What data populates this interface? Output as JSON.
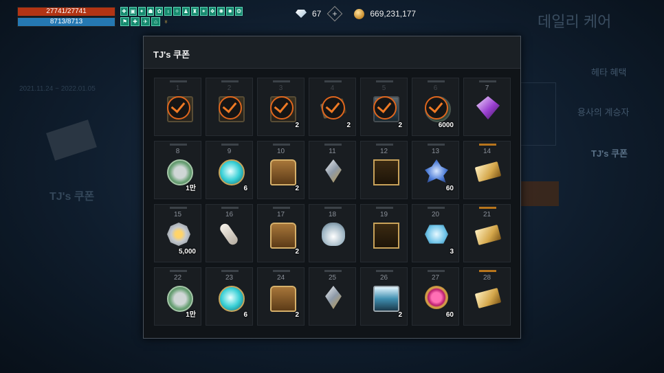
{
  "player": {
    "hp": "27741/27741",
    "mp": "8713/8713"
  },
  "currency": {
    "diamonds": "67",
    "gold": "669,231,177"
  },
  "background": {
    "title": "데일리 케어",
    "menu": [
      "헤타 혜택",
      "용사의 계승자",
      "TJ's 쿠폰"
    ],
    "date": "2021.11.24 ~ 2022.01.05",
    "card_title": "TJ's 쿠폰"
  },
  "modal": {
    "title": "TJ's 쿠폰",
    "items": [
      {
        "day": "1",
        "qty": "",
        "icon": "gift-box-icon",
        "claimed": true
      },
      {
        "day": "2",
        "qty": "",
        "icon": "chest-icon",
        "claimed": true
      },
      {
        "day": "3",
        "qty": "2",
        "icon": "chest-icon",
        "claimed": true
      },
      {
        "day": "4",
        "qty": "2",
        "icon": "ticket-icon",
        "claimed": true
      },
      {
        "day": "5",
        "qty": "2",
        "icon": "lantern-icon",
        "claimed": true
      },
      {
        "day": "6",
        "qty": "6000",
        "icon": "coin-icon",
        "claimed": true
      },
      {
        "day": "7",
        "qty": "",
        "icon": "purple-gem-icon",
        "claimed": false
      },
      {
        "day": "8",
        "qty": "1만",
        "icon": "silver-coin-icon",
        "claimed": false
      },
      {
        "day": "9",
        "qty": "6",
        "icon": "spirit-orb-icon",
        "claimed": false
      },
      {
        "day": "10",
        "qty": "2",
        "icon": "treasure-chest-icon",
        "claimed": false
      },
      {
        "day": "11",
        "qty": "",
        "icon": "crystal-shard-icon",
        "claimed": false
      },
      {
        "day": "12",
        "qty": "",
        "icon": "card-icon",
        "claimed": false
      },
      {
        "day": "13",
        "qty": "60",
        "icon": "blue-crystal-cluster-icon",
        "claimed": false
      },
      {
        "day": "14",
        "qty": "",
        "icon": "gold-ticket-icon",
        "claimed": false,
        "gold": true
      },
      {
        "day": "15",
        "qty": "5,000",
        "icon": "medal-icon",
        "claimed": false
      },
      {
        "day": "16",
        "qty": "",
        "icon": "scroll-icon",
        "claimed": false
      },
      {
        "day": "17",
        "qty": "2",
        "icon": "treasure-chest-icon",
        "claimed": false
      },
      {
        "day": "18",
        "qty": "",
        "icon": "potion-icon",
        "claimed": false
      },
      {
        "day": "19",
        "qty": "",
        "icon": "card-icon",
        "claimed": false
      },
      {
        "day": "20",
        "qty": "3",
        "icon": "sapphire-icon",
        "claimed": false
      },
      {
        "day": "21",
        "qty": "",
        "icon": "gold-ticket-icon",
        "claimed": false,
        "gold": true
      },
      {
        "day": "22",
        "qty": "1만",
        "icon": "silver-coin-icon",
        "claimed": false
      },
      {
        "day": "23",
        "qty": "6",
        "icon": "spirit-orb-icon",
        "claimed": false
      },
      {
        "day": "24",
        "qty": "2",
        "icon": "treasure-chest-icon",
        "claimed": false
      },
      {
        "day": "25",
        "qty": "",
        "icon": "crystal-shard-icon",
        "claimed": false
      },
      {
        "day": "26",
        "qty": "2",
        "icon": "lantern-icon",
        "claimed": false
      },
      {
        "day": "27",
        "qty": "60",
        "icon": "ring-icon",
        "claimed": false
      },
      {
        "day": "28",
        "qty": "",
        "icon": "gold-ticket-icon",
        "claimed": false,
        "gold": true
      }
    ]
  }
}
